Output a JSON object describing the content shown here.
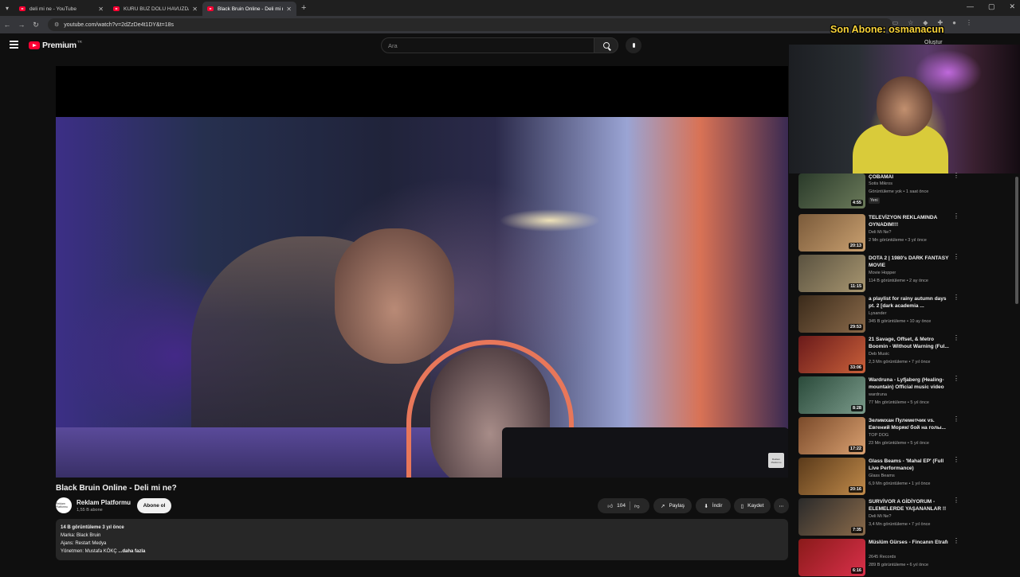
{
  "browser": {
    "tabs": [
      {
        "title": "deli mi ne - YouTube",
        "active": false
      },
      {
        "title": "KURU BUZ DOLU HAVUZDA KA",
        "active": false
      },
      {
        "title": "Black Bruin Online - Deli mi ne",
        "active": true
      }
    ],
    "url": "youtube.com/watch?v=2dZzDe4t1DY&t=18s"
  },
  "header": {
    "logo": "Premium",
    "logo_region": "TR",
    "search_placeholder": "Ara",
    "right_label": "Oluştur"
  },
  "overlay": {
    "sub_alert": "Son Abone: osmanacun"
  },
  "video": {
    "watermark": "Reklam Platformu",
    "title": "Black Bruin Online - Deli mi ne?",
    "channel": "Reklam Platformu",
    "channel_avatar": "Reklam Platformu",
    "subscribers": "1,55 B abone",
    "subscribe_label": "Abone ol",
    "likes": "104",
    "share_label": "Paylaş",
    "download_label": "İndir",
    "save_label": "Kaydet",
    "description": {
      "stats": "14 B görüntüleme  3 yıl önce",
      "line1": "Marka: Black Bruin",
      "line2": "Ajans: Restart Medya",
      "line3": "Yönetmen: Mustafa KÖKÇ",
      "more": "...daha fazla"
    }
  },
  "recommendations": [
    {
      "title": "ÇOBAMAI",
      "channel": "Sotis Mikros",
      "meta": "Görüntüleme yok • 1 saat önce",
      "badge": "Yeni",
      "duration": "4:55",
      "colors": [
        "#2a3a2a",
        "#6b7a5a"
      ]
    },
    {
      "title": "TELEVİZYON REKLAMINDA OYNADIM!!!",
      "channel": "Deli Mi Ne?",
      "meta": "2 Mn görüntüleme • 3 yıl önce",
      "duration": "20:13",
      "colors": [
        "#7a5a3a",
        "#c9a070"
      ]
    },
    {
      "title": "DOTA 2 | 1980's DARK FANTASY MOVIE",
      "channel": "Movie Hopper",
      "meta": "114 B görüntüleme • 2 ay önce",
      "duration": "11:15",
      "colors": [
        "#5a5240",
        "#a89670"
      ]
    },
    {
      "title": "a playlist for rainy autumn days pt. 2 [dark academia ...",
      "channel": "Lysander",
      "meta": "345 B görüntüleme • 10 ay önce",
      "duration": "29:53",
      "colors": [
        "#3a2a1a",
        "#8a6a4a"
      ]
    },
    {
      "title": "21 Savage, Offset, & Metro Boomin - Without Warning (Ful...",
      "channel": "Deb Music",
      "meta": "2,3 Mn görüntüleme • 7 yıl önce",
      "duration": "33:06",
      "colors": [
        "#6a1a1a",
        "#c9603a"
      ]
    },
    {
      "title": "Wardruna - Lyfjaberg (Healing-mountain) Official music video",
      "channel": "wardruna",
      "meta": "77 Mn görüntüleme • 5 yıl önce",
      "duration": "8:28",
      "colors": [
        "#2a4a3a",
        "#7a9a8a"
      ]
    },
    {
      "title": "Зелимхан Пулеметчик vs. Евгений Моряк/ бой на голы...",
      "channel": "TOP DOG",
      "meta": "23 Mn görüntüleme • 5 yıl önce",
      "duration": "17:22",
      "colors": [
        "#7a4a2a",
        "#d9a070"
      ]
    },
    {
      "title": "Glass Beams - 'Mahal EP' (Full Live Performance)",
      "channel": "Glass Beams",
      "meta": "6,9 Mn görüntüleme • 1 yıl önce",
      "duration": "20:16",
      "colors": [
        "#5a3a1a",
        "#c08a4a"
      ]
    },
    {
      "title": "SURVİVOR A GİDİYORUM - ELEMELERDE YAŞANANLAR !!",
      "channel": "Deli Mi Ne?",
      "meta": "3,4 Mn görüntüleme • 7 yıl önce",
      "duration": "7:35",
      "colors": [
        "#2a2a2a",
        "#8a6a4a"
      ]
    },
    {
      "title": "Müslüm Gürses - Fincanın Etrafı",
      "channel": "2645 Records",
      "meta": "289 B görüntüleme • 6 yıl önce",
      "duration": "6:16",
      "colors": [
        "#8a1a1a",
        "#d9304a"
      ]
    }
  ]
}
